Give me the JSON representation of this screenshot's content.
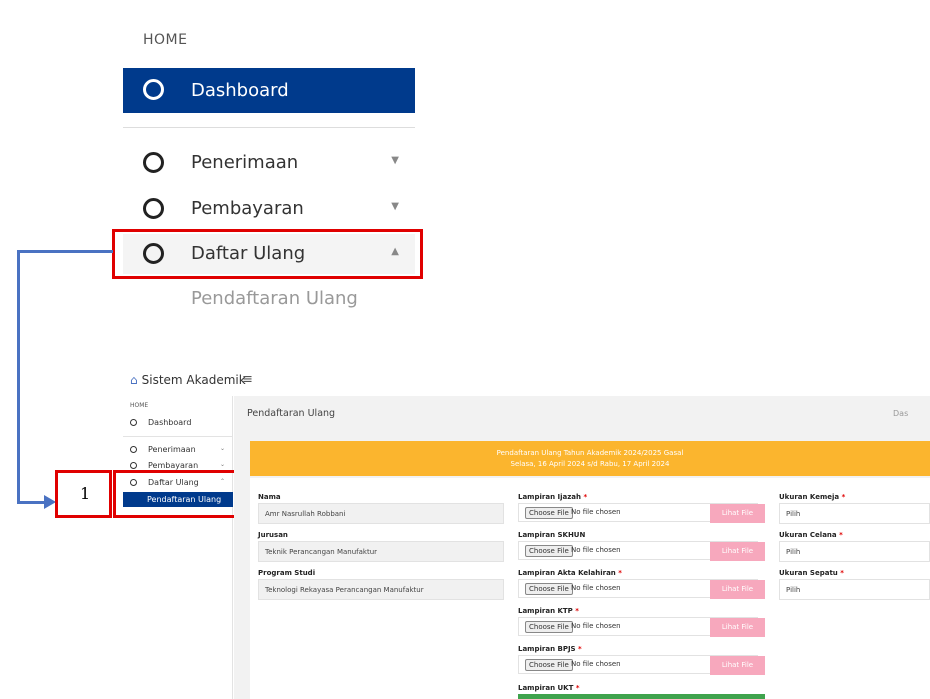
{
  "zoom": {
    "home_label": "HOME",
    "dashboard_label": "Dashboard",
    "menu": [
      {
        "label": "Penerimaan",
        "caret": "▼"
      },
      {
        "label": "Pembayaran",
        "caret": "▼"
      },
      {
        "label": "Daftar Ulang",
        "caret": "▲"
      }
    ],
    "submenu_label": "Pendaftaran Ulang"
  },
  "callout_number": "1",
  "app": {
    "title": "Sistem Akademik",
    "logo_icon": "⌂",
    "menu_icon": "≡"
  },
  "sidebar": {
    "home_label": "HOME",
    "items": [
      {
        "label": "Dashboard"
      },
      {
        "label": "Penerimaan",
        "caret": "⌄"
      },
      {
        "label": "Pembayaran",
        "caret": "⌄"
      },
      {
        "label": "Daftar Ulang",
        "caret": "⌃"
      }
    ],
    "active_sub": "Pendaftaran Ulang"
  },
  "page": {
    "title": "Pendaftaran Ulang",
    "breadcrumb": "Das",
    "banner_line1": "Pendaftaran Ulang Tahun Akademik 2024/2025 Gasal",
    "banner_line2": "Selasa, 16 April 2024 s/d Rabu, 17 April 2024"
  },
  "form": {
    "profile": [
      {
        "label": "Nama",
        "value": "Amr Nasrullah Robbani"
      },
      {
        "label": "Jurusan",
        "value": "Teknik Perancangan Manufaktur"
      },
      {
        "label": "Program Studi",
        "value": "Teknologi Rekayasa Perancangan Manufaktur"
      }
    ],
    "attachments": [
      {
        "label": "Lampiran Ijazah",
        "required": "*",
        "button": "Choose File",
        "status": "No file chosen",
        "view": "Lihat File"
      },
      {
        "label": "Lampiran SKHUN",
        "required": "",
        "button": "Choose File",
        "status": "No file chosen",
        "view": "Lihat File"
      },
      {
        "label": "Lampiran Akta Kelahiran",
        "required": "*",
        "button": "Choose File",
        "status": "No file chosen",
        "view": "Lihat File"
      },
      {
        "label": "Lampiran KTP",
        "required": "*",
        "button": "Choose File",
        "status": "No file chosen",
        "view": "Lihat File"
      },
      {
        "label": "Lampiran BPJS",
        "required": "*",
        "button": "Choose File",
        "status": "No file chosen",
        "view": "Lihat File"
      }
    ],
    "ukt_label": "Lampiran UKT",
    "ukt_required": "*",
    "sizes": [
      {
        "label": "Ukuran Kemeja",
        "required": "*",
        "value": "Pilih"
      },
      {
        "label": "Ukuran Celana",
        "required": "*",
        "value": "Pilih"
      },
      {
        "label": "Ukuran Sepatu",
        "required": "*",
        "value": "Pilih"
      }
    ]
  },
  "colors": {
    "primary": "#003a8c",
    "banner": "#fbb52e",
    "highlight": "#e00000",
    "connector": "#4a72c2",
    "view_button": "#f7a8bd",
    "upload_button": "#3fa34d"
  }
}
